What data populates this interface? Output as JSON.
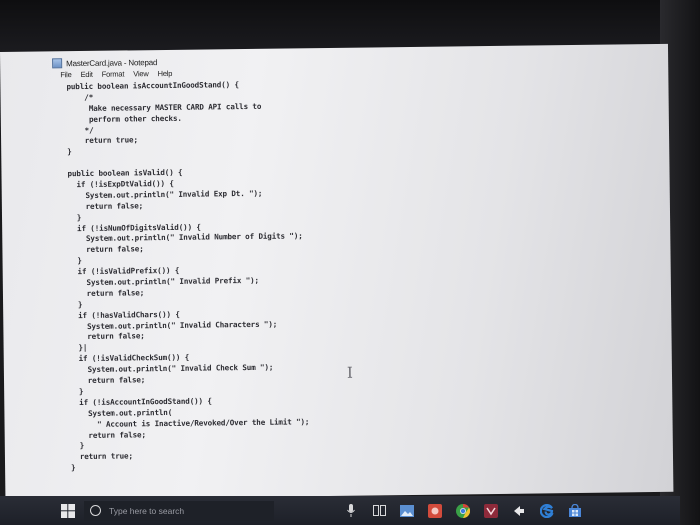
{
  "window": {
    "title": "MasterCard.java - Notepad",
    "menu": [
      "File",
      "Edit",
      "Format",
      "View",
      "Help"
    ]
  },
  "code_lines": [
    "public boolean isAccountInGoodStand() {",
    "    /*",
    "     Make necessary MASTER CARD API calls to",
    "     perform other checks.",
    "    */",
    "    return true;",
    "}",
    "",
    "public boolean isValid() {",
    "  if (!isExpDtValid()) {",
    "    System.out.println(\" Invalid Exp Dt. \");",
    "    return false;",
    "  }",
    "  if (!isNumOfDigitsValid()) {",
    "    System.out.println(\" Invalid Number of Digits \");",
    "    return false;",
    "  }",
    "  if (!isValidPrefix()) {",
    "    System.out.println(\" Invalid Prefix \");",
    "    return false;",
    "  }",
    "  if (!hasValidChars()) {",
    "    System.out.println(\" Invalid Characters \");",
    "    return false;",
    "  }|",
    "  if (!isValidCheckSum()) {",
    "    System.out.println(\" Invalid Check Sum \");",
    "    return false;",
    "  }",
    "  if (!isAccountInGoodStand()) {",
    "    System.out.println(",
    "      \" Account is Inactive/Revoked/Over the Limit \");",
    "    return false;",
    "  }",
    "  return true;",
    "}"
  ],
  "taskbar": {
    "search_placeholder": "Type here to search"
  },
  "colors": {
    "screen_bg": "#ececef",
    "code_text": "#2d2d33",
    "taskbar_bg": "#1f222a",
    "chrome_icon": "#3aa047",
    "edge_icon": "#2f7fd6"
  }
}
